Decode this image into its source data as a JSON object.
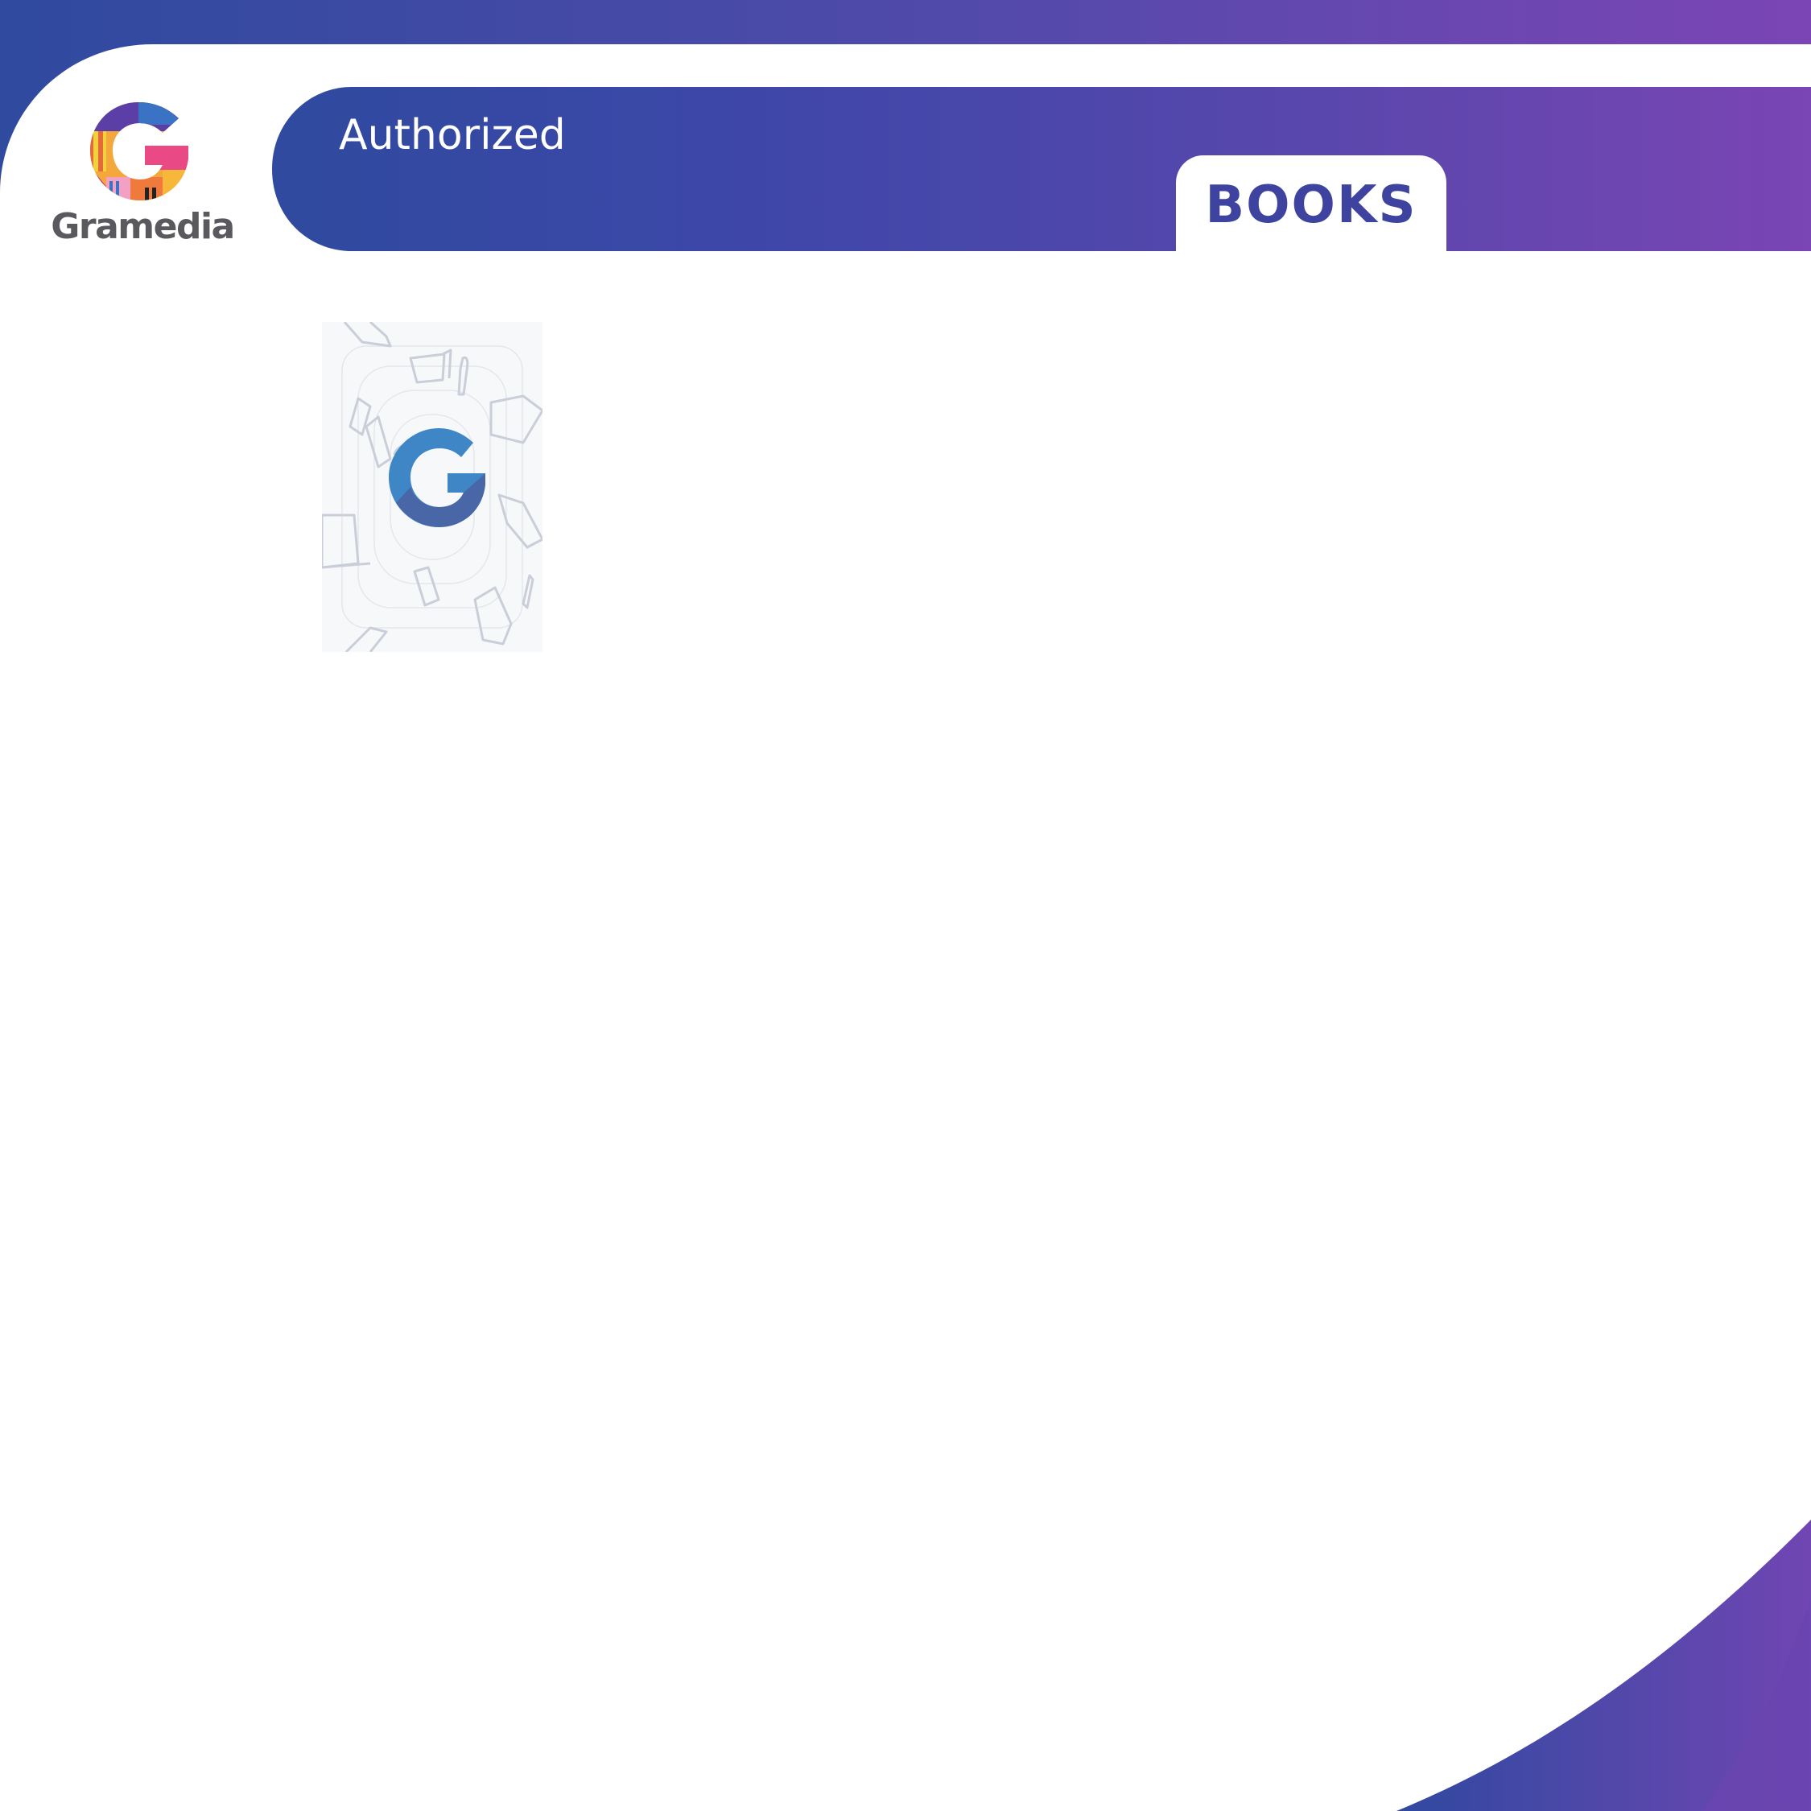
{
  "brand": {
    "wordmark": "Gramedia",
    "logo_icon": "gramedia-multicolor-g-icon"
  },
  "banner": {
    "title": "Authorized",
    "tab_label": "BOOKS"
  },
  "cover": {
    "icon": "gramedia-blue-g-icon",
    "pattern": "book-and-device-doodles"
  },
  "colors": {
    "gradient_start": "#3049a0",
    "gradient_mid": "#4a4aa8",
    "gradient_end": "#7b45b5",
    "tab_text": "#3e43a0",
    "wordmark_text": "#5a5a5e",
    "cover_g_blue": "#3f86c6",
    "cover_g_dark": "#4a5a9a"
  }
}
